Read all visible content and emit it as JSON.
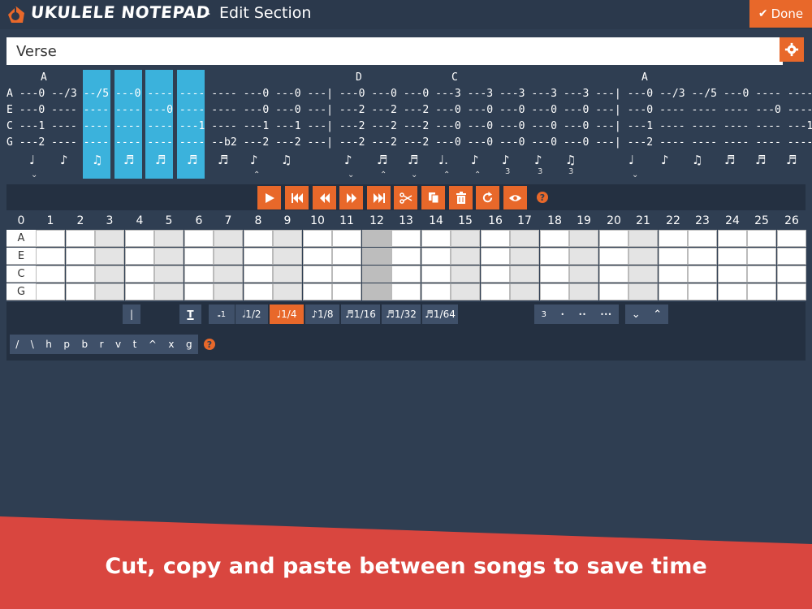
{
  "header": {
    "app_name": "UKULELE NOTEPAD",
    "separator": "-",
    "title": "Edit Section",
    "done_label": "Done"
  },
  "section_name": "Verse",
  "tab": {
    "chords": [
      {
        "label": "A",
        "col": 50
      },
      {
        "label": "D",
        "col": 438
      },
      {
        "label": "C",
        "col": 556
      },
      {
        "label": "A",
        "col": 790
      }
    ],
    "lines": [
      "A ---0 --/3 --/5 ---0 ---- ---- ---- ---0 ---0 ---| ---0 ---0 ---0 ---3 ---3 ---3 ---3 ---3 ---| ---0 --/3 --/5 ---0 ---- ----",
      "E ---0 ---- ---- ---- ---0 ---- ---- ---0 ---0 ---| ---2 ---2 ---2 ---0 ---0 ---0 ---0 ---0 ---| ---0 ---- ---- ---- ---0 ----",
      "C ---1 ---- ---- ---- ---- ---1 ---- ---1 ---1 ---| ---2 ---2 ---2 ---0 ---0 ---0 ---0 ---0 ---| ---1 ---- ---- ---- ---- ---1",
      "G ---2 ---- ---- ---- ---- ---- --b2 ---2 ---2 ---| ---2 ---2 ---2 ---0 ---0 ---0 ---0 ---0 ---| ---2 ---- ---- ---- ---- ----"
    ],
    "note_values": [
      "♩",
      "♪",
      "♫",
      "♬",
      "♬",
      "♬",
      "♬",
      "♪",
      "♫",
      "♪",
      "♬",
      "♬",
      "♩.",
      "♪",
      "♪",
      "♪",
      "♫",
      "♩",
      "♪",
      "♫",
      "♬",
      "♬",
      "♬"
    ],
    "note_marks": [
      "⌄",
      "",
      "",
      "",
      "",
      "",
      "",
      "⌃",
      "",
      "",
      "⌄",
      "⌃",
      "⌄",
      "⌃",
      "⌃",
      "3",
      "3",
      "3",
      "⌄"
    ]
  },
  "toolbar": {
    "icons": [
      "play-icon",
      "skip-start-icon",
      "rewind-icon",
      "forward-icon",
      "skip-end-icon",
      "cut-icon",
      "copy-icon",
      "trash-icon",
      "refresh-icon",
      "eye-icon"
    ]
  },
  "fretboard": {
    "frets": [
      "0",
      "1",
      "2",
      "3",
      "4",
      "5",
      "6",
      "7",
      "8",
      "9",
      "10",
      "11",
      "12",
      "13",
      "14",
      "15",
      "16",
      "17",
      "18",
      "19",
      "20",
      "21",
      "22",
      "23",
      "24",
      "25",
      "26"
    ],
    "strings": [
      "A",
      "E",
      "C",
      "G"
    ]
  },
  "durations": [
    "1",
    "1/2",
    "1/4",
    "1/8",
    "1/16",
    "1/32",
    "1/64"
  ],
  "active_duration": "1/4",
  "modifiers": {
    "bar": "|",
    "tie": "T",
    "triplet": "3",
    "dot1": "•",
    "dot2": "••",
    "dot3": "•••"
  },
  "techniques": [
    "/",
    "\\",
    "h",
    "p",
    "b",
    "r",
    "v",
    "t",
    "^",
    "x",
    "g"
  ],
  "banner": {
    "text": "Cut, copy and paste between songs to save time",
    "color": "#d9463f"
  },
  "colors": {
    "accent": "#e8682a",
    "highlight": "#3bb2dc",
    "background": "#2f3e52"
  }
}
